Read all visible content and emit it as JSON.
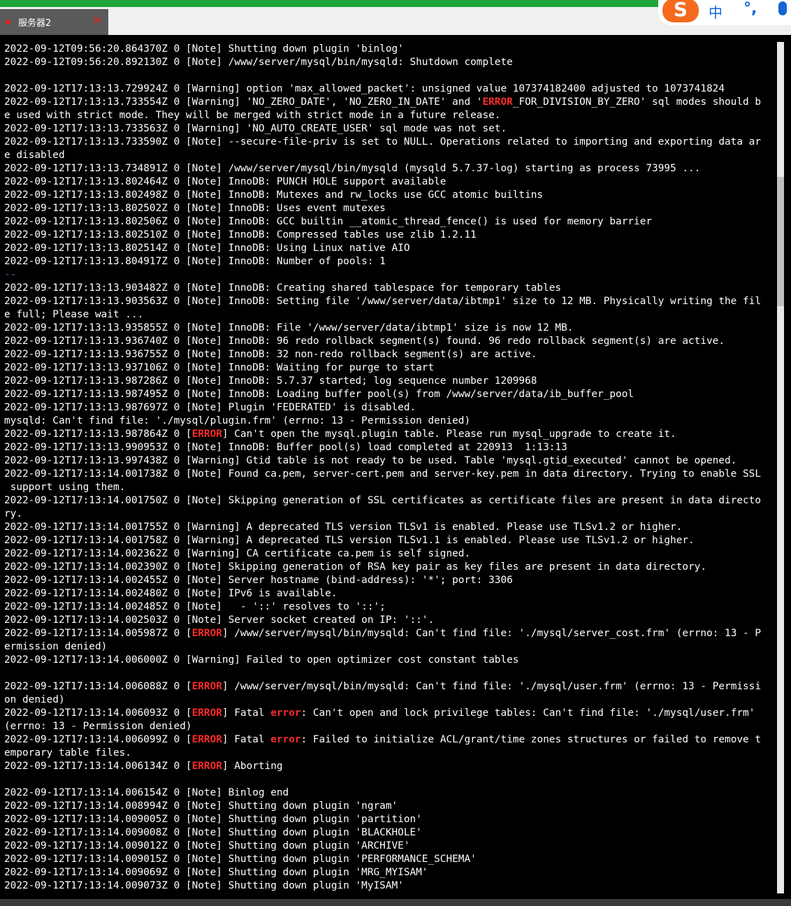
{
  "tab": {
    "title": "服务器2",
    "close_glyph": "✕",
    "status_dot_color": "#e02020"
  },
  "ime": {
    "logo_letter": "S",
    "lang": "中",
    "punct": "°,",
    "mic_icon": "microphone-icon"
  },
  "colors": {
    "error_text": "#ff2a2a",
    "background": "#000000",
    "text": "#ffffff",
    "tab_bg": "#5a5a5a",
    "accent_bar": "#20a53a"
  },
  "log": {
    "lines": [
      [
        {
          "t": "2022-09-12T09:56:20.864370Z 0 [Note] Shutting down plugin 'binlog'"
        }
      ],
      [
        {
          "t": "2022-09-12T09:56:20.892130Z 0 [Note] /www/server/mysql/bin/mysqld: Shutdown complete"
        }
      ],
      [
        {
          "t": ""
        }
      ],
      [
        {
          "t": "2022-09-12T17:13:13.729924Z 0 [Warning] option 'max_allowed_packet': unsigned value 107374182400 adjusted to 1073741824"
        }
      ],
      [
        {
          "t": "2022-09-12T17:13:13.733554Z 0 [Warning] 'NO_ZERO_DATE', 'NO_ZERO_IN_DATE' and '"
        },
        {
          "t": "ERROR",
          "c": "err"
        },
        {
          "t": "_FOR_DIVISION_BY_ZERO' sql modes should b"
        }
      ],
      [
        {
          "t": "e used with strict mode. They will be merged with strict mode in a future release."
        }
      ],
      [
        {
          "t": "2022-09-12T17:13:13.733563Z 0 [Warning] 'NO_AUTO_CREATE_USER' sql mode was not set."
        }
      ],
      [
        {
          "t": "2022-09-12T17:13:13.733590Z 0 [Note] --secure-file-priv is set to NULL. Operations related to importing and exporting data ar"
        }
      ],
      [
        {
          "t": "e disabled"
        }
      ],
      [
        {
          "t": "2022-09-12T17:13:13.734891Z 0 [Note] /www/server/mysql/bin/mysqld (mysqld 5.7.37-log) starting as process 73995 ..."
        }
      ],
      [
        {
          "t": "2022-09-12T17:13:13.802464Z 0 [Note] InnoDB: PUNCH HOLE support available"
        }
      ],
      [
        {
          "t": "2022-09-12T17:13:13.802498Z 0 [Note] InnoDB: Mutexes and rw_locks use GCC atomic builtins"
        }
      ],
      [
        {
          "t": "2022-09-12T17:13:13.802502Z 0 [Note] InnoDB: Uses event mutexes"
        }
      ],
      [
        {
          "t": "2022-09-12T17:13:13.802506Z 0 [Note] InnoDB: GCC builtin __atomic_thread_fence() is used for memory barrier"
        }
      ],
      [
        {
          "t": "2022-09-12T17:13:13.802510Z 0 [Note] InnoDB: Compressed tables use zlib 1.2.11"
        }
      ],
      [
        {
          "t": "2022-09-12T17:13:13.802514Z 0 [Note] InnoDB: Using Linux native AIO"
        }
      ],
      [
        {
          "t": "2022-09-12T17:13:13.804917Z 0 [Note] InnoDB: Number of pools: 1"
        }
      ],
      [
        {
          "t": "--",
          "c": "faint"
        }
      ],
      [
        {
          "t": "2022-09-12T17:13:13.903482Z 0 [Note] InnoDB: Creating shared tablespace for temporary tables"
        }
      ],
      [
        {
          "t": "2022-09-12T17:13:13.903563Z 0 [Note] InnoDB: Setting file '/www/server/data/ibtmp1' size to 12 MB. Physically writing the fil"
        }
      ],
      [
        {
          "t": "e full; Please wait ..."
        }
      ],
      [
        {
          "t": "2022-09-12T17:13:13.935855Z 0 [Note] InnoDB: File '/www/server/data/ibtmp1' size is now 12 MB."
        }
      ],
      [
        {
          "t": "2022-09-12T17:13:13.936740Z 0 [Note] InnoDB: 96 redo rollback segment(s) found. 96 redo rollback segment(s) are active."
        }
      ],
      [
        {
          "t": "2022-09-12T17:13:13.936755Z 0 [Note] InnoDB: 32 non-redo rollback segment(s) are active."
        }
      ],
      [
        {
          "t": "2022-09-12T17:13:13.937106Z 0 [Note] InnoDB: Waiting for purge to start"
        }
      ],
      [
        {
          "t": "2022-09-12T17:13:13.987286Z 0 [Note] InnoDB: 5.7.37 started; log sequence number 1209968"
        }
      ],
      [
        {
          "t": "2022-09-12T17:13:13.987495Z 0 [Note] InnoDB: Loading buffer pool(s) from /www/server/data/ib_buffer_pool"
        }
      ],
      [
        {
          "t": "2022-09-12T17:13:13.987697Z 0 [Note] Plugin 'FEDERATED' is disabled."
        }
      ],
      [
        {
          "t": "mysqld: Can't find file: './mysql/plugin.frm' (errno: 13 - Permission denied)"
        }
      ],
      [
        {
          "t": "2022-09-12T17:13:13.987864Z 0 ["
        },
        {
          "t": "ERROR",
          "c": "err"
        },
        {
          "t": "] Can't open the mysql.plugin table. Please run mysql_upgrade to create it."
        }
      ],
      [
        {
          "t": "2022-09-12T17:13:13.990953Z 0 [Note] InnoDB: Buffer pool(s) load completed at 220913  1:13:13"
        }
      ],
      [
        {
          "t": "2022-09-12T17:13:13.997438Z 0 [Warning] Gtid table is not ready to be used. Table 'mysql.gtid_executed' cannot be opened."
        }
      ],
      [
        {
          "t": "2022-09-12T17:13:14.001738Z 0 [Note] Found ca.pem, server-cert.pem and server-key.pem in data directory. Trying to enable SSL"
        }
      ],
      [
        {
          "t": " support using them."
        }
      ],
      [
        {
          "t": "2022-09-12T17:13:14.001750Z 0 [Note] Skipping generation of SSL certificates as certificate files are present in data directo"
        }
      ],
      [
        {
          "t": "ry."
        }
      ],
      [
        {
          "t": "2022-09-12T17:13:14.001755Z 0 [Warning] A deprecated TLS version TLSv1 is enabled. Please use TLSv1.2 or higher."
        }
      ],
      [
        {
          "t": "2022-09-12T17:13:14.001758Z 0 [Warning] A deprecated TLS version TLSv1.1 is enabled. Please use TLSv1.2 or higher."
        }
      ],
      [
        {
          "t": "2022-09-12T17:13:14.002362Z 0 [Warning] CA certificate ca.pem is self signed."
        }
      ],
      [
        {
          "t": "2022-09-12T17:13:14.002390Z 0 [Note] Skipping generation of RSA key pair as key files are present in data directory."
        }
      ],
      [
        {
          "t": "2022-09-12T17:13:14.002455Z 0 [Note] Server hostname (bind-address): '*'; port: 3306"
        }
      ],
      [
        {
          "t": "2022-09-12T17:13:14.002480Z 0 [Note] IPv6 is available."
        }
      ],
      [
        {
          "t": "2022-09-12T17:13:14.002485Z 0 [Note]   - '::' resolves to '::';"
        }
      ],
      [
        {
          "t": "2022-09-12T17:13:14.002503Z 0 [Note] Server socket created on IP: '::'."
        }
      ],
      [
        {
          "t": "2022-09-12T17:13:14.005987Z 0 ["
        },
        {
          "t": "ERROR",
          "c": "err"
        },
        {
          "t": "] /www/server/mysql/bin/mysqld: Can't find file: './mysql/server_cost.frm' (errno: 13 - P"
        }
      ],
      [
        {
          "t": "ermission denied)"
        }
      ],
      [
        {
          "t": "2022-09-12T17:13:14.006000Z 0 [Warning] Failed to open optimizer cost constant tables"
        }
      ],
      [
        {
          "t": ""
        }
      ],
      [
        {
          "t": "2022-09-12T17:13:14.006088Z 0 ["
        },
        {
          "t": "ERROR",
          "c": "err"
        },
        {
          "t": "] /www/server/mysql/bin/mysqld: Can't find file: './mysql/user.frm' (errno: 13 - Permissi"
        }
      ],
      [
        {
          "t": "on denied)"
        }
      ],
      [
        {
          "t": "2022-09-12T17:13:14.006093Z 0 ["
        },
        {
          "t": "ERROR",
          "c": "err"
        },
        {
          "t": "] Fatal "
        },
        {
          "t": "error",
          "c": "err"
        },
        {
          "t": ": Can't open and lock privilege tables: Can't find file: './mysql/user.frm'"
        }
      ],
      [
        {
          "t": "(errno: 13 - Permission denied)"
        }
      ],
      [
        {
          "t": "2022-09-12T17:13:14.006099Z 0 ["
        },
        {
          "t": "ERROR",
          "c": "err"
        },
        {
          "t": "] Fatal "
        },
        {
          "t": "error",
          "c": "err"
        },
        {
          "t": ": Failed to initialize ACL/grant/time zones structures or failed to remove t"
        }
      ],
      [
        {
          "t": "emporary table files."
        }
      ],
      [
        {
          "t": "2022-09-12T17:13:14.006134Z 0 ["
        },
        {
          "t": "ERROR",
          "c": "err"
        },
        {
          "t": "] Aborting"
        }
      ],
      [
        {
          "t": ""
        }
      ],
      [
        {
          "t": "2022-09-12T17:13:14.006154Z 0 [Note] Binlog end"
        }
      ],
      [
        {
          "t": "2022-09-12T17:13:14.008994Z 0 [Note] Shutting down plugin 'ngram'"
        }
      ],
      [
        {
          "t": "2022-09-12T17:13:14.009005Z 0 [Note] Shutting down plugin 'partition'"
        }
      ],
      [
        {
          "t": "2022-09-12T17:13:14.009008Z 0 [Note] Shutting down plugin 'BLACKHOLE'"
        }
      ],
      [
        {
          "t": "2022-09-12T17:13:14.009012Z 0 [Note] Shutting down plugin 'ARCHIVE'"
        }
      ],
      [
        {
          "t": "2022-09-12T17:13:14.009015Z 0 [Note] Shutting down plugin 'PERFORMANCE_SCHEMA'"
        }
      ],
      [
        {
          "t": "2022-09-12T17:13:14.009069Z 0 [Note] Shutting down plugin 'MRG_MYISAM'"
        }
      ],
      [
        {
          "t": "2022-09-12T17:13:14.009073Z 0 [Note] Shutting down plugin 'MyISAM'"
        }
      ]
    ]
  }
}
